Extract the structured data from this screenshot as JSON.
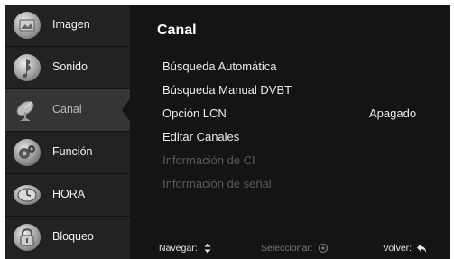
{
  "sidebar": {
    "items": [
      {
        "label": "Imagen",
        "icon": "picture-icon"
      },
      {
        "label": "Sonido",
        "icon": "music-note-icon"
      },
      {
        "label": "Canal",
        "icon": "satellite-dish-icon",
        "active": true
      },
      {
        "label": "Función",
        "icon": "gears-icon"
      },
      {
        "label": "HORA",
        "icon": "clock-icon"
      },
      {
        "label": "Bloqueo",
        "icon": "padlock-icon"
      }
    ]
  },
  "main": {
    "title": "Canal",
    "options": [
      {
        "label": "Búsqueda Automática",
        "enabled": true
      },
      {
        "label": "Búsqueda Manual DVBT",
        "enabled": true
      },
      {
        "label": "Opción LCN",
        "enabled": true,
        "value": "Apagado"
      },
      {
        "label": "Editar Canales",
        "enabled": true
      },
      {
        "label": "Información de CI",
        "enabled": false
      },
      {
        "label": "Información de señal",
        "enabled": false
      }
    ]
  },
  "footer": {
    "navigate_label": "Navegar:",
    "select_label": "Seleccionar:",
    "back_label": "Volver:"
  },
  "colors": {
    "background": "#141414",
    "sidebar": "#222222",
    "sidebar_active": "#353535",
    "text": "#ececec",
    "text_disabled": "#5a5a5a"
  }
}
